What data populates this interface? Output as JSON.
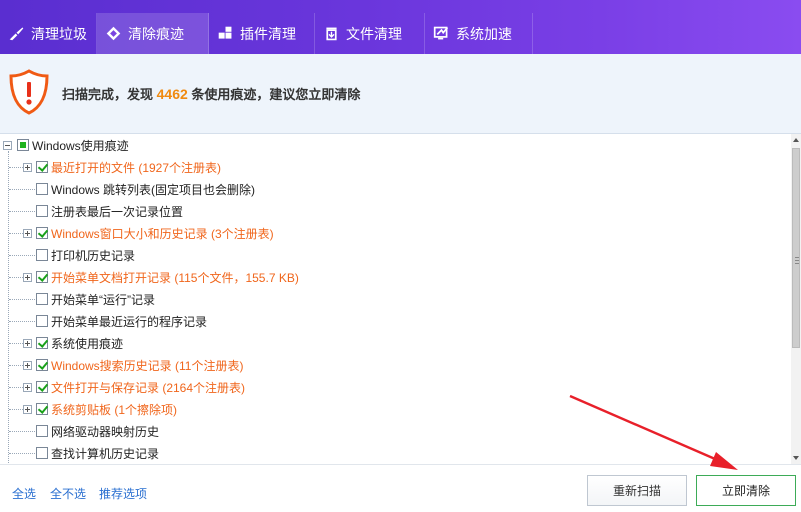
{
  "tabs": [
    {
      "label": "清理垃圾",
      "icon": "broom-icon",
      "active": false
    },
    {
      "label": "清除痕迹",
      "icon": "eraser-icon",
      "active": true
    },
    {
      "label": "插件清理",
      "icon": "plugin-icon",
      "active": false
    },
    {
      "label": "文件清理",
      "icon": "file-trash-icon",
      "active": false
    },
    {
      "label": "系统加速",
      "icon": "speedup-icon",
      "active": false
    }
  ],
  "header": {
    "msg_prefix": "扫描完成，发现",
    "count": "4462",
    "msg_suffix": "条使用痕迹，建议您立即清除",
    "icon": "warning-shield-icon"
  },
  "tree": {
    "root_label": "Windows使用痕迹",
    "items": [
      {
        "label": "最近打开的文件 (1927个注册表)",
        "checked": true,
        "expandable": true,
        "highlight": true
      },
      {
        "label": "Windows 跳转列表(固定项目也会删除)",
        "checked": false,
        "expandable": false,
        "highlight": false
      },
      {
        "label": "注册表最后一次记录位置",
        "checked": false,
        "expandable": false,
        "highlight": false
      },
      {
        "label": "Windows窗口大小和历史记录 (3个注册表)",
        "checked": true,
        "expandable": true,
        "highlight": true
      },
      {
        "label": "打印机历史记录",
        "checked": false,
        "expandable": false,
        "highlight": false
      },
      {
        "label": "开始菜单文档打开记录 (115个文件，155.7 KB)",
        "checked": true,
        "expandable": true,
        "highlight": true
      },
      {
        "label": "开始菜单“运行”记录",
        "checked": false,
        "expandable": false,
        "highlight": false
      },
      {
        "label": "开始菜单最近运行的程序记录",
        "checked": false,
        "expandable": false,
        "highlight": false
      },
      {
        "label": "系统使用痕迹",
        "checked": true,
        "expandable": true,
        "highlight": false
      },
      {
        "label": "Windows搜索历史记录 (11个注册表)",
        "checked": true,
        "expandable": true,
        "highlight": true
      },
      {
        "label": "文件打开与保存记录 (2164个注册表)",
        "checked": true,
        "expandable": true,
        "highlight": true
      },
      {
        "label": "系统剪贴板 (1个擦除项)",
        "checked": true,
        "expandable": true,
        "highlight": true
      },
      {
        "label": "网络驱动器映射历史",
        "checked": false,
        "expandable": false,
        "highlight": false
      },
      {
        "label": "查找计算机历史记录",
        "checked": false,
        "expandable": false,
        "highlight": false
      }
    ]
  },
  "footer": {
    "select_all": "全选",
    "select_none": "全不选",
    "recommended": "推荐选项",
    "rescan": "重新扫描",
    "clean_now": "立即清除"
  },
  "colors": {
    "tab_bar": "#6a36dc",
    "highlight_text": "#f0661c",
    "count": "#f08a10",
    "link": "#2a6fd0",
    "arrow": "#e8202a"
  }
}
